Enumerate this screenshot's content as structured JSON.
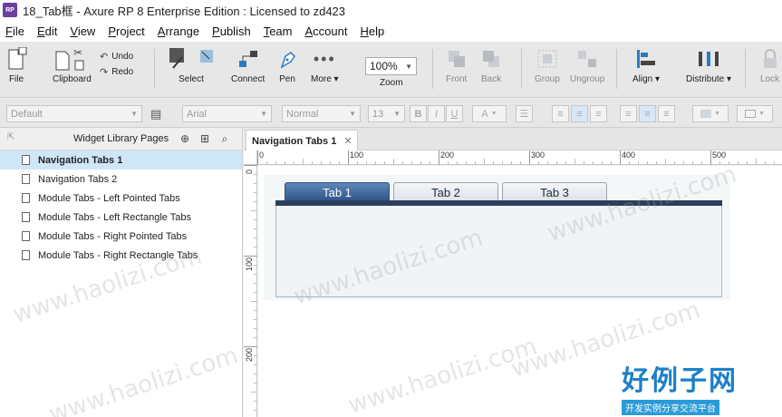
{
  "window": {
    "title": "18_Tab框 - Axure RP 8 Enterprise Edition : Licensed to zd423",
    "app_icon_text": "RP"
  },
  "menu": [
    "File",
    "Edit",
    "View",
    "Project",
    "Arrange",
    "Publish",
    "Team",
    "Account",
    "Help"
  ],
  "toolbar": {
    "file": "File",
    "clipboard": "Clipboard",
    "undo": "Undo",
    "redo": "Redo",
    "select": "Select",
    "connect": "Connect",
    "pen": "Pen",
    "more": "More ▾",
    "zoom_value": "100%",
    "zoom_label": "Zoom",
    "front": "Front",
    "back": "Back",
    "group": "Group",
    "ungroup": "Ungroup",
    "align": "Align ▾",
    "distribute": "Distribute ▾",
    "lock": "Lock"
  },
  "formatbar": {
    "style": "Default",
    "font": "Arial",
    "weight": "Normal",
    "size": "13",
    "bold": "B",
    "italic": "I",
    "underline": "U",
    "text_color": "A"
  },
  "left_panel": {
    "title": "Widget Library Pages",
    "pages": [
      {
        "label": "Navigation Tabs 1",
        "selected": true
      },
      {
        "label": "Navigation Tabs 2"
      },
      {
        "label": "Module Tabs - Left Pointed Tabs"
      },
      {
        "label": "Module Tabs - Left Rectangle Tabs"
      },
      {
        "label": "Module Tabs - Right Pointed Tabs"
      },
      {
        "label": "Module Tabs - Right Rectangle Tabs"
      }
    ]
  },
  "canvas": {
    "doc_tab": "Navigation Tabs 1",
    "ruler_h": [
      "0",
      "100",
      "200",
      "300",
      "400",
      "500"
    ],
    "ruler_v": [
      "0",
      "100",
      "200"
    ],
    "tabs": [
      {
        "label": "Tab 1",
        "active": true
      },
      {
        "label": "Tab 2"
      },
      {
        "label": "Tab 3"
      }
    ]
  },
  "watermark": {
    "text": "www.haolizi.com",
    "brand": "好例子网",
    "brand_sub": "开发实例分享交流平台"
  },
  "colors": {
    "active_tab": "#3b5f92",
    "tab_bar": "#2c3e5c",
    "selected_row": "#cfe6f7",
    "brand": "#1d7fc7"
  }
}
